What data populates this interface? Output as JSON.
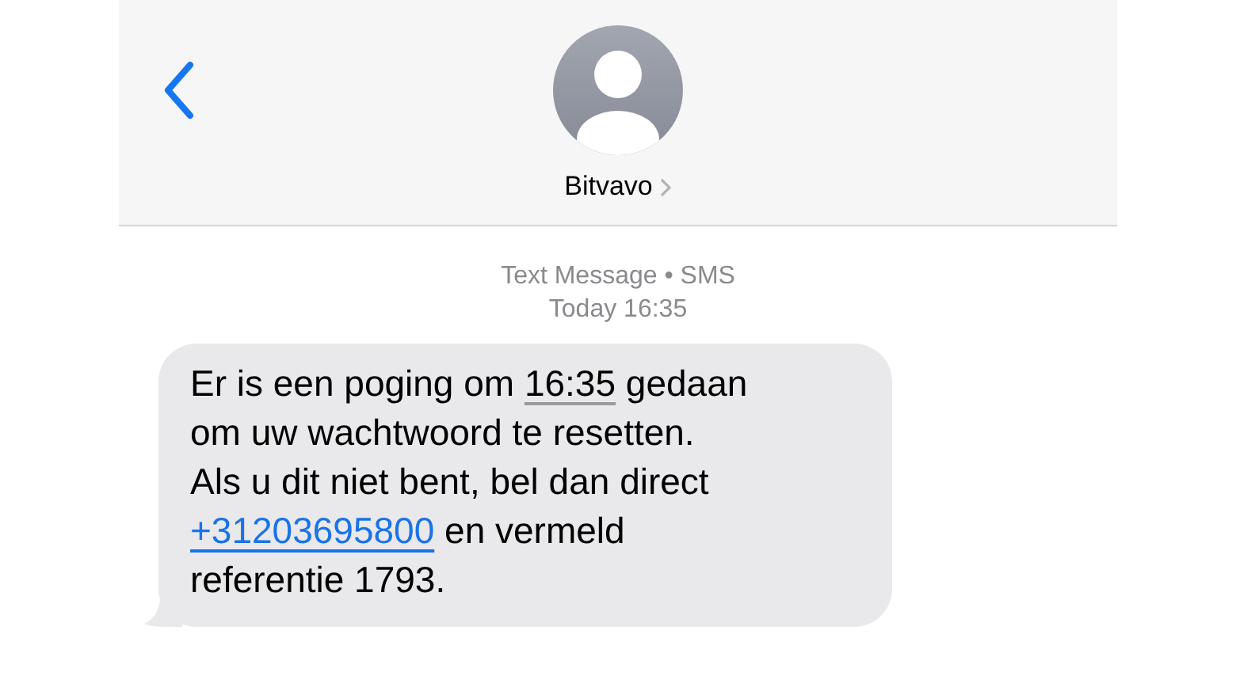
{
  "header": {
    "contact_name": "Bitvavo"
  },
  "thread": {
    "service": "Text Message • SMS",
    "timestamp": "Today 16:35"
  },
  "messages": [
    {
      "incoming": true,
      "lines": [
        [
          {
            "kind": "plain",
            "text": "Er is een poging om "
          },
          {
            "kind": "time",
            "text": "16:35"
          },
          {
            "kind": "plain",
            "text": " gedaan"
          }
        ],
        [
          {
            "kind": "plain",
            "text": "om uw wachtwoord te resetten."
          }
        ],
        [
          {
            "kind": "plain",
            "text": "Als u dit niet bent, bel dan direct"
          }
        ],
        [
          {
            "kind": "phone",
            "text": "+31203695800"
          },
          {
            "kind": "plain",
            "text": " en vermeld"
          }
        ],
        [
          {
            "kind": "plain",
            "text": "referentie 1793."
          }
        ]
      ]
    }
  ]
}
